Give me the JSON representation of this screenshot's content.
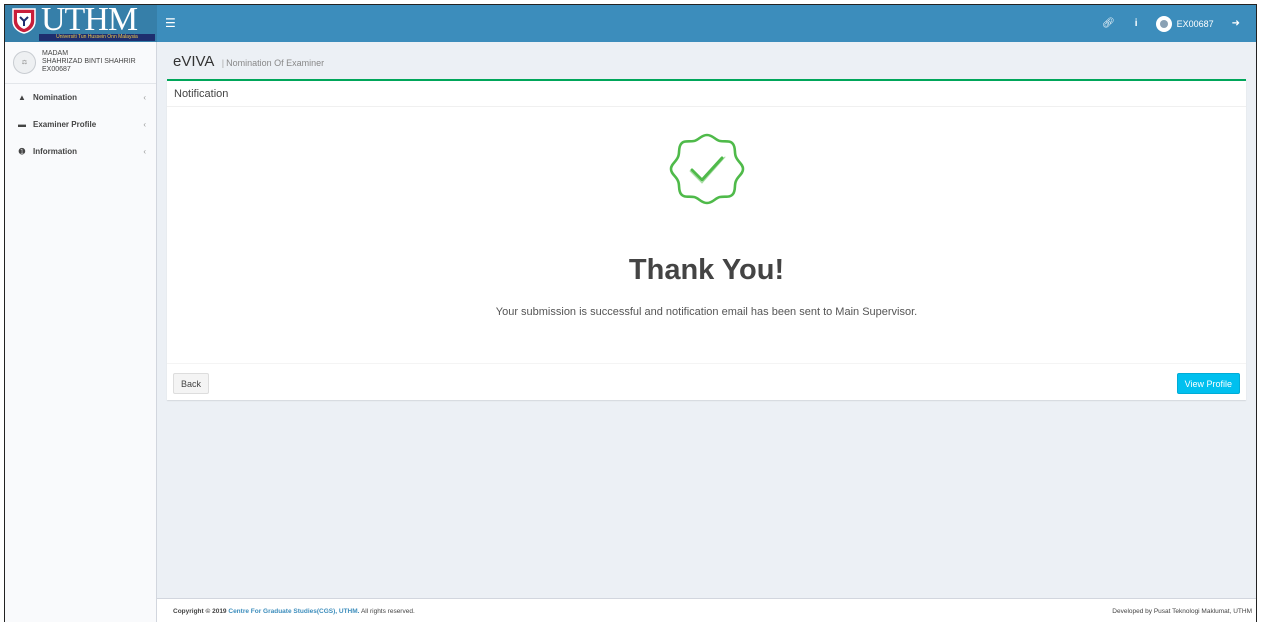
{
  "header": {
    "logo_text": "UTHM",
    "logo_subtitle": "Universiti Tun Hussein Onn Malaysia",
    "menu_icon": "hamburger-icon",
    "user_code": "EX00687",
    "icons": [
      "link-icon",
      "info-icon",
      "avatar",
      "sign-out-icon"
    ]
  },
  "sidebar": {
    "user": {
      "title": "MADAM",
      "name": "SHAHRIZAD BINTI SHAHRIR",
      "code": "EX00687"
    },
    "items": [
      {
        "label": "Nomination",
        "icon": "user-tie-icon"
      },
      {
        "label": "Examiner Profile",
        "icon": "id-card-icon"
      },
      {
        "label": "Information",
        "icon": "info-circle-icon"
      }
    ]
  },
  "content": {
    "title": "eVIVA",
    "subtitle": "Nomination Of Examiner",
    "box_title": "Notification",
    "thank_title": "Thank You!",
    "message": "Your submission is successful and notification email has been sent to Main Supervisor.",
    "back_label": "Back",
    "view_profile_label": "View Profile"
  },
  "footer": {
    "copyright": "Copyright © 2019",
    "org_link": "Centre For Graduate Studies(CGS), UTHM.",
    "rights": "All rights reserved.",
    "developer": "Developed by Pusat Teknologi Maklumat, UTHM"
  },
  "colors": {
    "header": "#3c8dbc",
    "success": "#00a65a",
    "check": "#4fba4a",
    "info_button": "#00c0ef"
  }
}
